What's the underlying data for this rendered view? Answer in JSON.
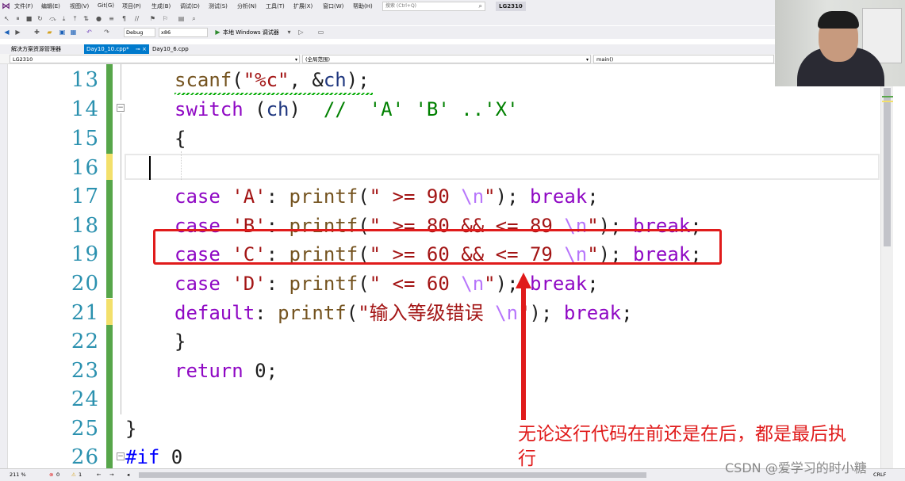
{
  "menubar": {
    "items": [
      "文件(F)",
      "编辑(E)",
      "视图(V)",
      "Git(G)",
      "项目(P)",
      "生成(B)",
      "调试(D)",
      "测试(S)",
      "分析(N)",
      "工具(T)",
      "扩展(X)",
      "窗口(W)",
      "帮助(H)"
    ],
    "search_placeholder": "搜索 (Ctrl+Q)",
    "solution_name": "LG2310"
  },
  "toolbar": {
    "config": "Debug",
    "platform": "x86",
    "run_label": "本地 Windows 调试器"
  },
  "tabs": {
    "panel": "解决方案资源管理器",
    "active": "Day10_10.cpp*",
    "other": "Day10_6.cpp"
  },
  "navbar": {
    "project": "LG2310",
    "scope": "(全局范围)",
    "member": "main()"
  },
  "editor": {
    "line_numbers": [
      "13",
      "14",
      "15",
      "16",
      "17",
      "18",
      "19",
      "20",
      "21",
      "22",
      "23",
      "24",
      "25",
      "26"
    ]
  },
  "annotation": {
    "text": "无论这行代码在前还是在后，都是最后执行"
  },
  "statusbar": {
    "zoom": "211 %",
    "errors": "0",
    "warnings": "1",
    "line_ending": "CRLF"
  },
  "watermark": "CSDN @爱学习的时小糖",
  "colors": {
    "accent": "#007acc",
    "highlight": "#e01b1b",
    "gutter_saved": "#57a64a",
    "gutter_changed": "#f3e06b"
  }
}
